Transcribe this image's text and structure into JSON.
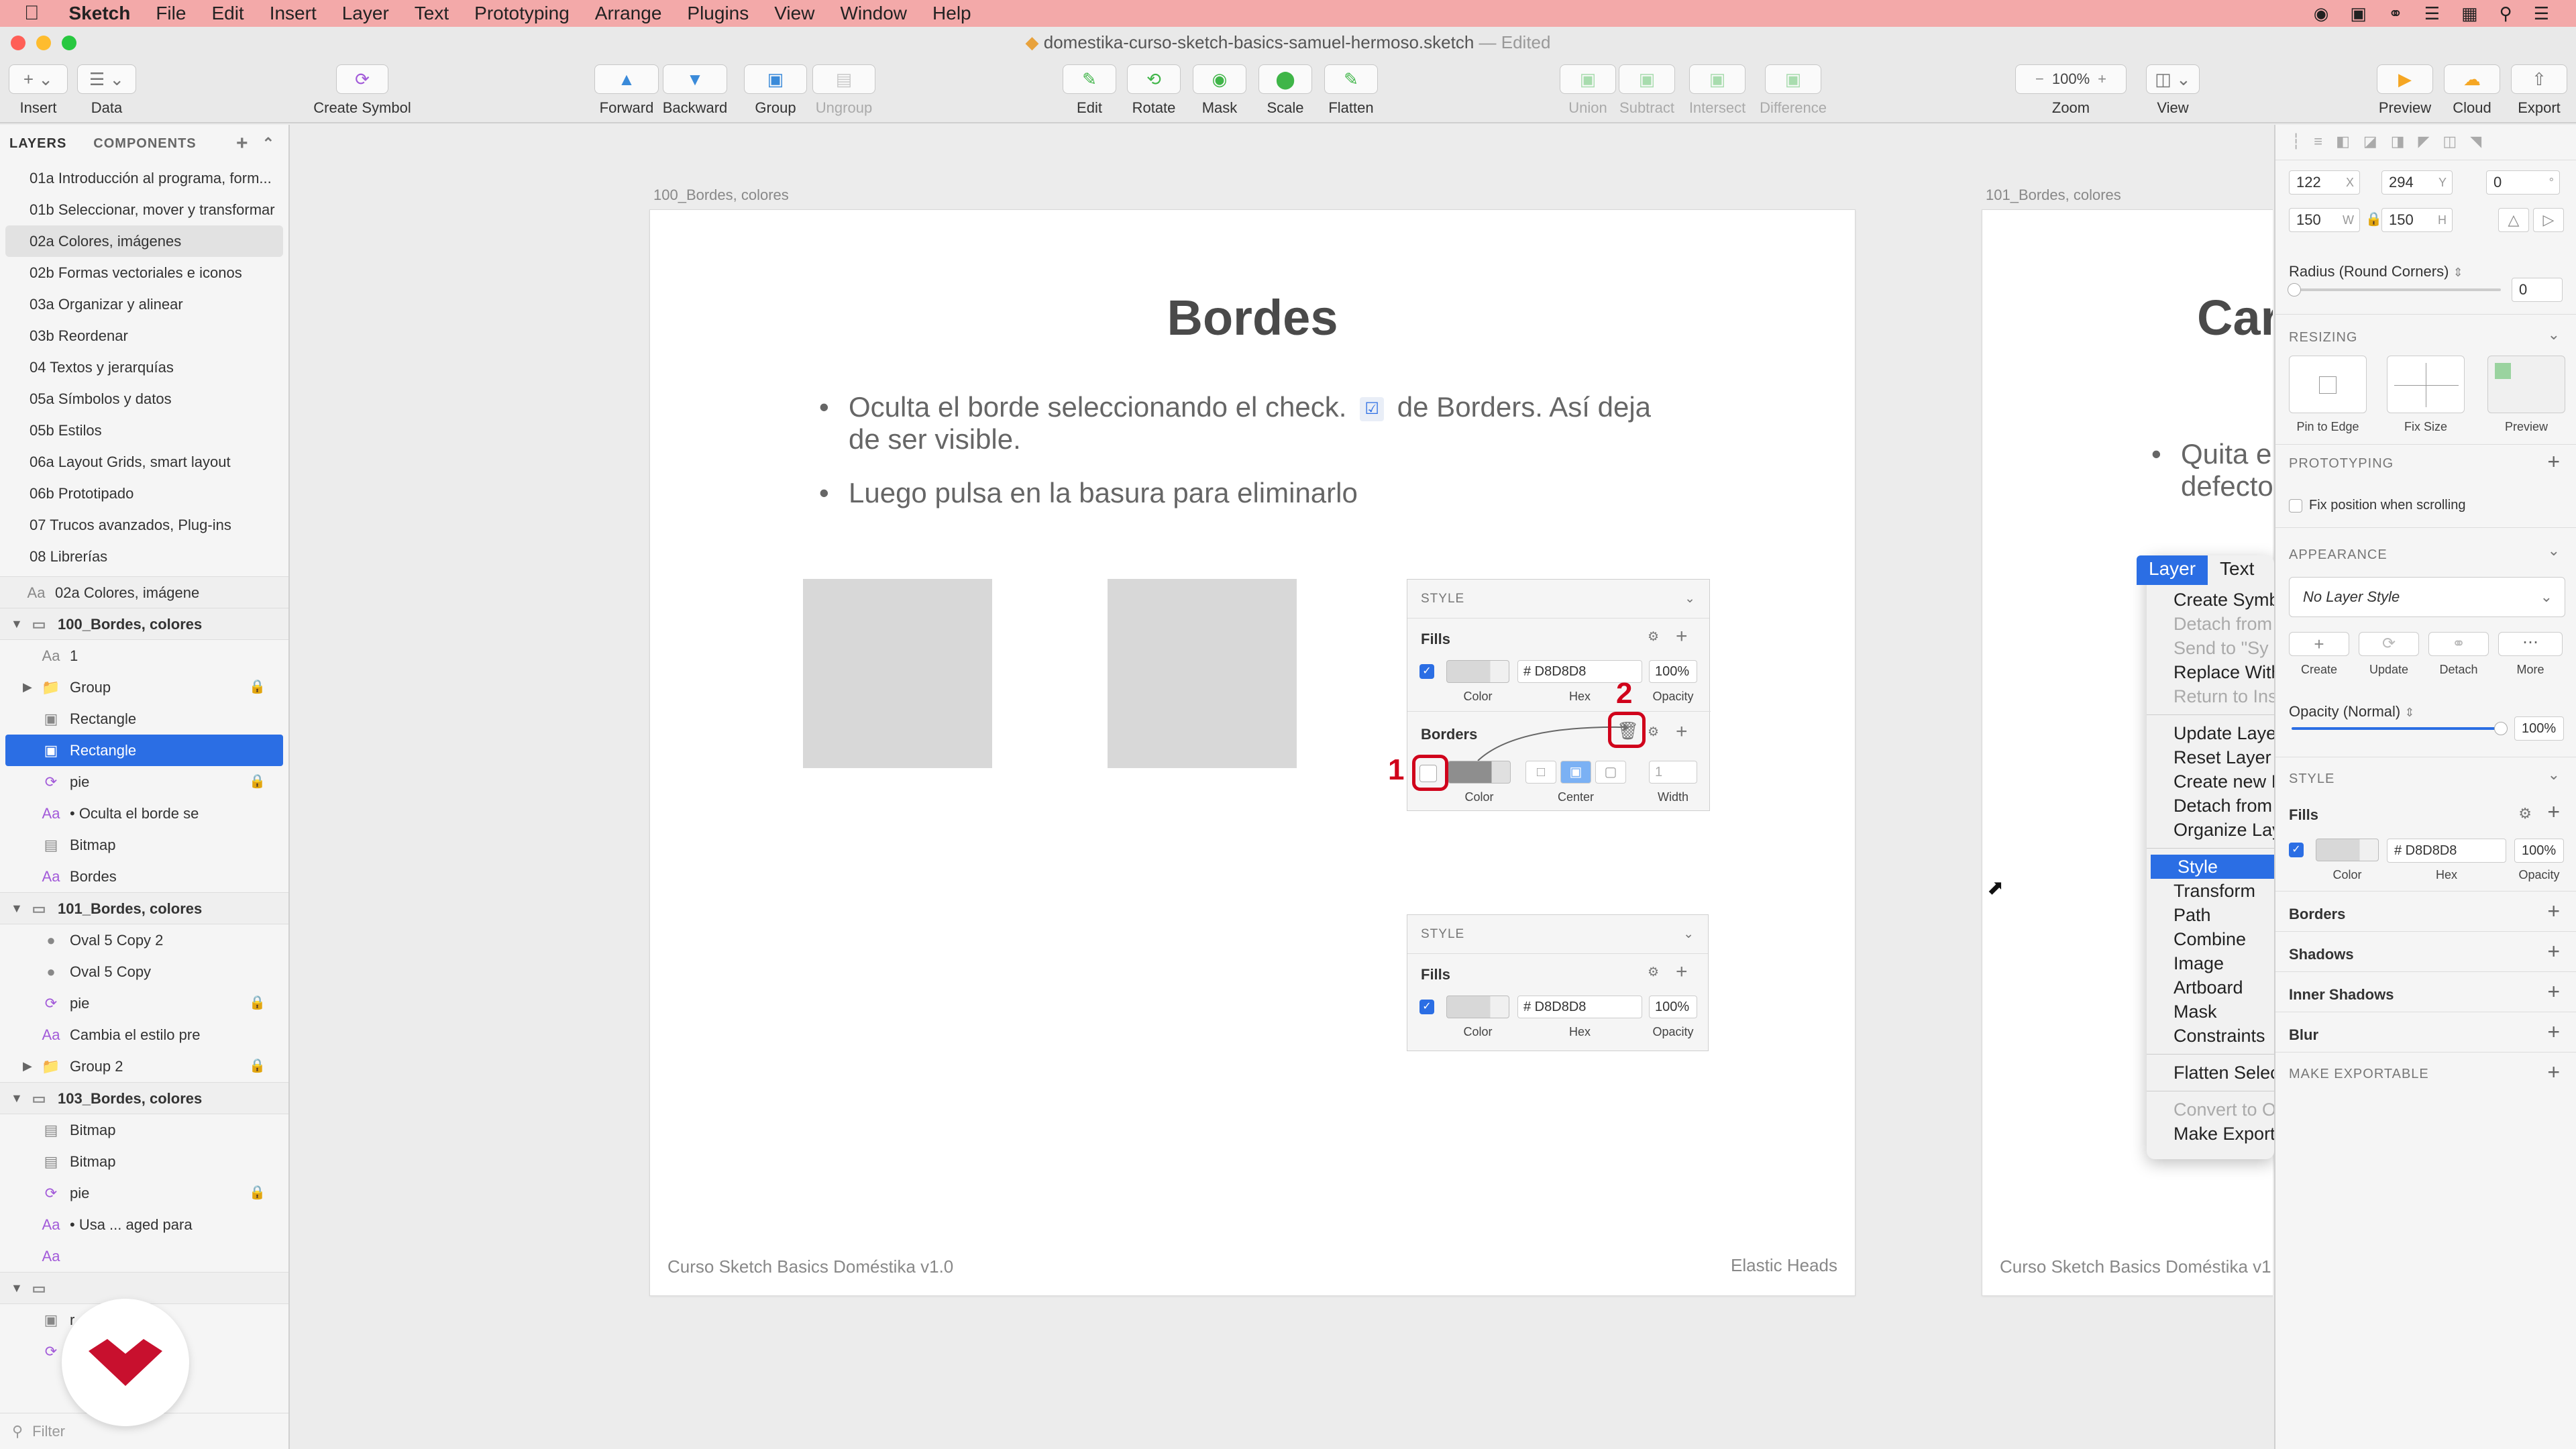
{
  "menubar": {
    "app": "Sketch",
    "items": [
      "File",
      "Edit",
      "Insert",
      "Layer",
      "Text",
      "Prototyping",
      "Arrange",
      "Plugins",
      "View",
      "Window",
      "Help"
    ]
  },
  "window": {
    "title": "domestika-curso-sketch-basics-samuel-hermoso.sketch",
    "edited": "— Edited"
  },
  "toolbar": {
    "insert": "Insert",
    "data": "Data",
    "create_symbol": "Create Symbol",
    "forward": "Forward",
    "backward": "Backward",
    "group": "Group",
    "ungroup": "Ungroup",
    "edit": "Edit",
    "rotate": "Rotate",
    "mask": "Mask",
    "scale": "Scale",
    "flatten": "Flatten",
    "union": "Union",
    "subtract": "Subtract",
    "intersect": "Intersect",
    "difference": "Difference",
    "zoom_value": "100%",
    "zoom": "Zoom",
    "view": "View",
    "preview": "Preview",
    "cloud": "Cloud",
    "export": "Export"
  },
  "left_panel": {
    "tab_layers": "LAYERS",
    "tab_components": "COMPONENTS",
    "pages": [
      "01a Introducción al programa, form...",
      "01b Seleccionar, mover y transformar",
      "02a Colores, imágenes",
      "02b Formas vectoriales e iconos",
      "03a Organizar y alinear",
      "03b Reordenar",
      "04 Textos y jerarquías",
      "05a Símbolos y datos",
      "05b Estilos",
      "06a Layout Grids, smart layout",
      "06b Prototipado",
      "07 Trucos avanzados, Plug-ins",
      "08 Librerías"
    ],
    "current_page": "02a Colores, imágene",
    "artboard1": "100_Bordes, colores",
    "ab1_layers": [
      "1",
      "Group",
      "Rectangle",
      "Rectangle",
      "pie",
      "• Oculta el borde se",
      "Bitmap",
      "Bordes"
    ],
    "artboard2": "101_Bordes, colores",
    "ab2_layers": [
      "Oval 5 Copy 2",
      "Oval 5 Copy",
      "pie",
      "Cambia el estilo pre",
      "Group 2"
    ],
    "artboard3": "103_Bordes, colores",
    "ab3_layers": [
      "Bitmap",
      "Bitmap",
      "pie",
      "• Usa ... aged para"
    ],
    "partial": [
      "r",
      "pie"
    ],
    "filter": "Filter"
  },
  "canvas": {
    "artboard1_label": "100_Bordes, colores",
    "artboard2_label": "101_Bordes, colores",
    "slide_title": "Bordes",
    "bullet1_a": "Oculta el borde seleccionando el check.",
    "bullet1_b": "de Borders. Así deja",
    "bullet1_c": "de ser visible.",
    "bullet2": "Luego pulsa en la basura para eliminarlo",
    "footer_left": "Curso Sketch Basics Doméstika v1.0",
    "footer_right": "Elastic Heads",
    "ab2_title_partial": "Car",
    "ab2_bullet_a": "Quita e",
    "ab2_bullet_b": "defecto",
    "ab2_footer_partial": "Curso Sketch Basics Doméstika v1.0",
    "panel1": {
      "style": "STYLE",
      "fills": "Fills",
      "hex": "# D8D8D8",
      "opacity": "100%",
      "cap_color": "Color",
      "cap_hex": "Hex",
      "cap_opacity": "Opacity",
      "borders": "Borders",
      "width_val": "1",
      "cap_center": "Center",
      "cap_width": "Width",
      "mark1": "1",
      "mark2": "2"
    },
    "panel2": {
      "style": "STYLE",
      "fills": "Fills",
      "hex": "# D8D8D8",
      "opacity": "100%",
      "cap_color": "Color",
      "cap_hex": "Hex",
      "cap_opacity": "Opacity"
    }
  },
  "context_menu": {
    "tab_layer": "Layer",
    "tab_text": "Text",
    "items": [
      {
        "label": "Create Symb",
        "state": "normal"
      },
      {
        "label": "Detach from",
        "state": "disabled"
      },
      {
        "label": "Send to \"Sy",
        "state": "disabled"
      },
      {
        "label": "Replace With",
        "state": "normal"
      },
      {
        "label": "Return to Ins",
        "state": "disabled"
      },
      {
        "sep": true
      },
      {
        "label": "Update Laye",
        "state": "normal"
      },
      {
        "label": "Reset Layer",
        "state": "normal"
      },
      {
        "label": "Create new I",
        "state": "normal"
      },
      {
        "label": "Detach from",
        "state": "normal"
      },
      {
        "label": "Organize Lay",
        "state": "normal"
      },
      {
        "sep": true
      },
      {
        "label": "Style",
        "state": "selected"
      },
      {
        "label": "Transform",
        "state": "normal"
      },
      {
        "label": "Path",
        "state": "normal"
      },
      {
        "label": "Combine",
        "state": "normal"
      },
      {
        "label": "Image",
        "state": "normal"
      },
      {
        "label": "Artboard",
        "state": "normal"
      },
      {
        "label": "Mask",
        "state": "normal"
      },
      {
        "label": "Constraints",
        "state": "normal"
      },
      {
        "sep": true
      },
      {
        "label": "Flatten Selec",
        "state": "normal"
      },
      {
        "sep": true
      },
      {
        "label": "Convert to O",
        "state": "disabled"
      },
      {
        "label": "Make Export",
        "state": "normal"
      }
    ]
  },
  "right_panel": {
    "x": "122",
    "x_label": "X",
    "y": "294",
    "y_label": "Y",
    "rot": "0",
    "rot_label": "°",
    "w": "150",
    "w_label": "W",
    "h": "150",
    "h_label": "H",
    "radius_label": "Radius (Round Corners)",
    "radius_value": "0",
    "resizing": "RESIZING",
    "pin_to_edge": "Pin to Edge",
    "fix_size": "Fix Size",
    "preview": "Preview",
    "prototyping": "PROTOTYPING",
    "fix_position": "Fix position when scrolling",
    "appearance": "APPEARANCE",
    "layer_style": "No Layer Style",
    "create": "Create",
    "update": "Update",
    "detach": "Detach",
    "more": "More",
    "opacity_label": "Opacity (Normal)",
    "opacity_value": "100%",
    "style": "STYLE",
    "fills": "Fills",
    "fill_hex": "# D8D8D8",
    "fill_opacity": "100%",
    "cap_color": "Color",
    "cap_hex": "Hex",
    "cap_opacity": "Opacity",
    "borders": "Borders",
    "shadows": "Shadows",
    "inner_shadows": "Inner Shadows",
    "blur": "Blur",
    "make_exportable": "MAKE EXPORTABLE"
  },
  "colors": {
    "accent": "#2b6ee4",
    "menubar_bg": "#f3a9a9",
    "fill": "#d8d8d8",
    "annotation_red": "#d0021b",
    "brand": "#c8102e"
  }
}
